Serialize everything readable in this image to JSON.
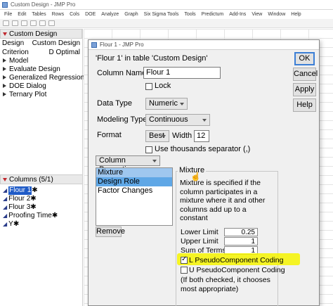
{
  "window": {
    "title": "Custom Design - JMP Pro",
    "menu": [
      "File",
      "Edit",
      "Tables",
      "Rows",
      "Cols",
      "DOE",
      "Analyze",
      "Graph",
      "Six Sigma Tools",
      "Tools",
      "Predictum",
      "Add-Ins",
      "View",
      "Window",
      "Help"
    ]
  },
  "left_panel": {
    "table_name": "Custom Design",
    "table_props": [
      {
        "key": "Design",
        "value": "Custom Design"
      },
      {
        "key": "Criterion",
        "value": "D Optimal"
      }
    ],
    "scripts": [
      "Model",
      "Evaluate Design",
      "Generalized Regression",
      "DOE Dialog",
      "Ternary Plot"
    ],
    "columns_header": "Columns (5/1)",
    "columns": [
      {
        "label": "Flour 1",
        "marker": "✱",
        "selected": true
      },
      {
        "label": "Flour 2",
        "marker": "✱",
        "selected": false
      },
      {
        "label": "Flour 3",
        "marker": "✱",
        "selected": false
      },
      {
        "label": "Proofing Time",
        "marker": "✱",
        "selected": false
      },
      {
        "label": "Y",
        "marker": "✱",
        "selected": false
      }
    ]
  },
  "dialog": {
    "title": "Flour 1 - JMP Pro",
    "table_note": "'Flour 1' in table 'Custom Design'",
    "column_name_label": "Column Name",
    "column_name_value": "Flour 1",
    "lock_label": "Lock",
    "data_type_label": "Data Type",
    "data_type_value": "Numeric",
    "modeling_type_label": "Modeling Type",
    "modeling_type_value": "Continuous",
    "format_label": "Format",
    "format_value": "Best",
    "width_label": "Width",
    "width_value": "12",
    "thousands_label": "Use thousands separator (,)",
    "column_properties_label": "Column Properties",
    "properties": [
      "Mixture",
      "Design Role",
      "Factor Changes"
    ],
    "remove_label": "Remove",
    "buttons": {
      "ok": "OK",
      "cancel": "Cancel",
      "apply": "Apply",
      "help": "Help"
    },
    "mixture": {
      "title": "Mixture",
      "description": "Mixture is specified if the column participates in a mixture where it and other columns add up to a constant",
      "lower_limit_label": "Lower Limit",
      "lower_limit_value": "0.25",
      "upper_limit_label": "Upper Limit",
      "upper_limit_value": "1",
      "sum_terms_label": "Sum of Terms",
      "sum_terms_value": "1",
      "l_pseudo_label": "L PseudoComponent Coding",
      "l_pseudo_checked": true,
      "u_pseudo_label": "U PseudoComponent Coding",
      "u_pseudo_checked": false,
      "note": "(If both checked, it chooses most appropriate)"
    }
  }
}
